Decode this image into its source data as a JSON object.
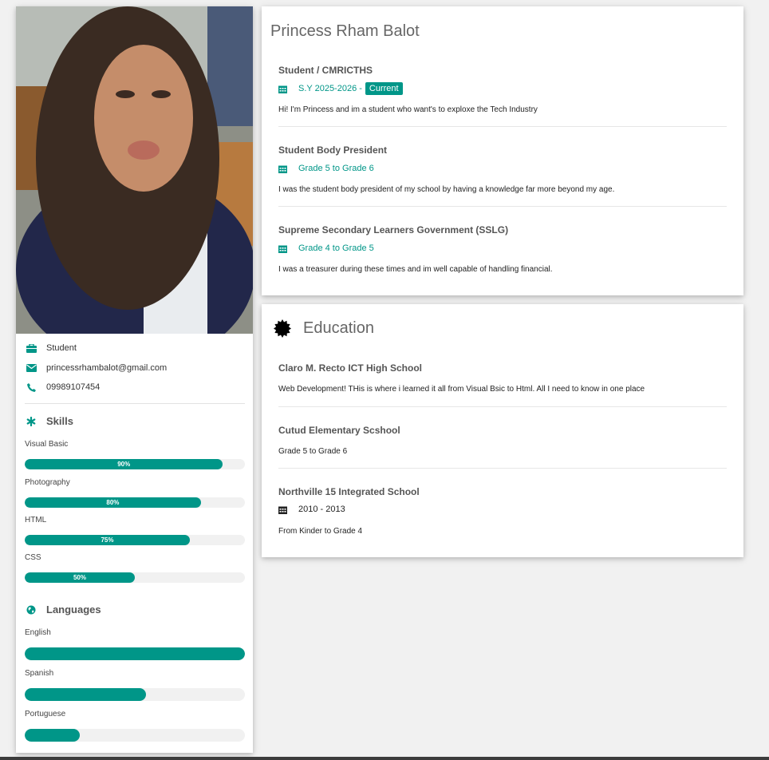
{
  "profile": {
    "role": "Student",
    "email": "princessrhambalot@gmail.com",
    "phone": "09989107454"
  },
  "skills": {
    "title": "Skills",
    "items": [
      {
        "label": "Visual Basic",
        "percent": 90,
        "text": "90%"
      },
      {
        "label": "Photography",
        "percent": 80,
        "text": "80%"
      },
      {
        "label": "HTML",
        "percent": 75,
        "text": "75%"
      },
      {
        "label": "CSS",
        "percent": 50,
        "text": "50%"
      }
    ]
  },
  "languages": {
    "title": "Languages",
    "items": [
      {
        "label": "English",
        "percent": 100
      },
      {
        "label": "Spanish",
        "percent": 55
      },
      {
        "label": "Portuguese",
        "percent": 25
      }
    ]
  },
  "work": {
    "name": "Princess Rham Balot",
    "entries": [
      {
        "title": "Student / CMRICTHS",
        "date": "S.Y 2025-2026 -",
        "badge": "Current",
        "desc": "Hi! I'm Princess and im a student who want's to exploxe the Tech Industry"
      },
      {
        "title": "Student Body President",
        "date": "Grade 5 to Grade 6",
        "desc": "I was the student body president of my school by having a knowledge far more beyond my age."
      },
      {
        "title": "Supreme Secondary Learners Government (SSLG)",
        "date": "Grade 4 to Grade 5",
        "desc": "I was a treasurer during these times and im well capable of handling financial."
      }
    ]
  },
  "education": {
    "title": "Education",
    "entries": [
      {
        "title": "Claro M. Recto ICT High School",
        "desc": "Web Development! THis is where i learned it all from Visual Bsic to Html. All I need to know in one place"
      },
      {
        "title": "Cutud Elementary Scshool",
        "desc": "Grade 5 to Grade 6"
      },
      {
        "title": "Northville 15 Integrated School",
        "date": "2010 - 2013",
        "desc": "From Kinder to Grade 4"
      }
    ]
  },
  "colors": {
    "accent": "#009688",
    "background": "#f1f1f1",
    "card": "#ffffff"
  },
  "icons": [
    "briefcase-icon",
    "envelope-icon",
    "phone-icon",
    "asterisk-icon",
    "globe-icon",
    "calendar-icon",
    "certificate-icon"
  ]
}
